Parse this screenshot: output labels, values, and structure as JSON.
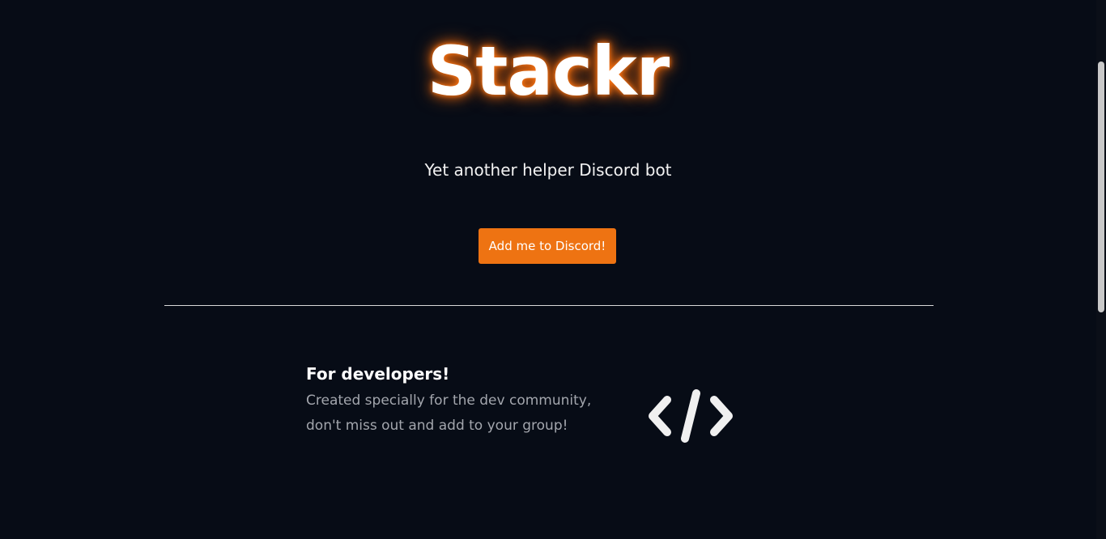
{
  "hero": {
    "title": "Stackr",
    "tagline": "Yet another helper Discord bot",
    "cta_label": "Add me to Discord!"
  },
  "feature": {
    "heading": "For developers!",
    "lines": [
      "Created specially for the dev community,",
      "don't miss out and add to your group!"
    ],
    "icon": "code-icon"
  },
  "colors": {
    "background": "#070c16",
    "accent": "#ee7312",
    "glow": "#f26a0b",
    "text": "#ffffff",
    "muted_text": "#a3a6ad"
  }
}
